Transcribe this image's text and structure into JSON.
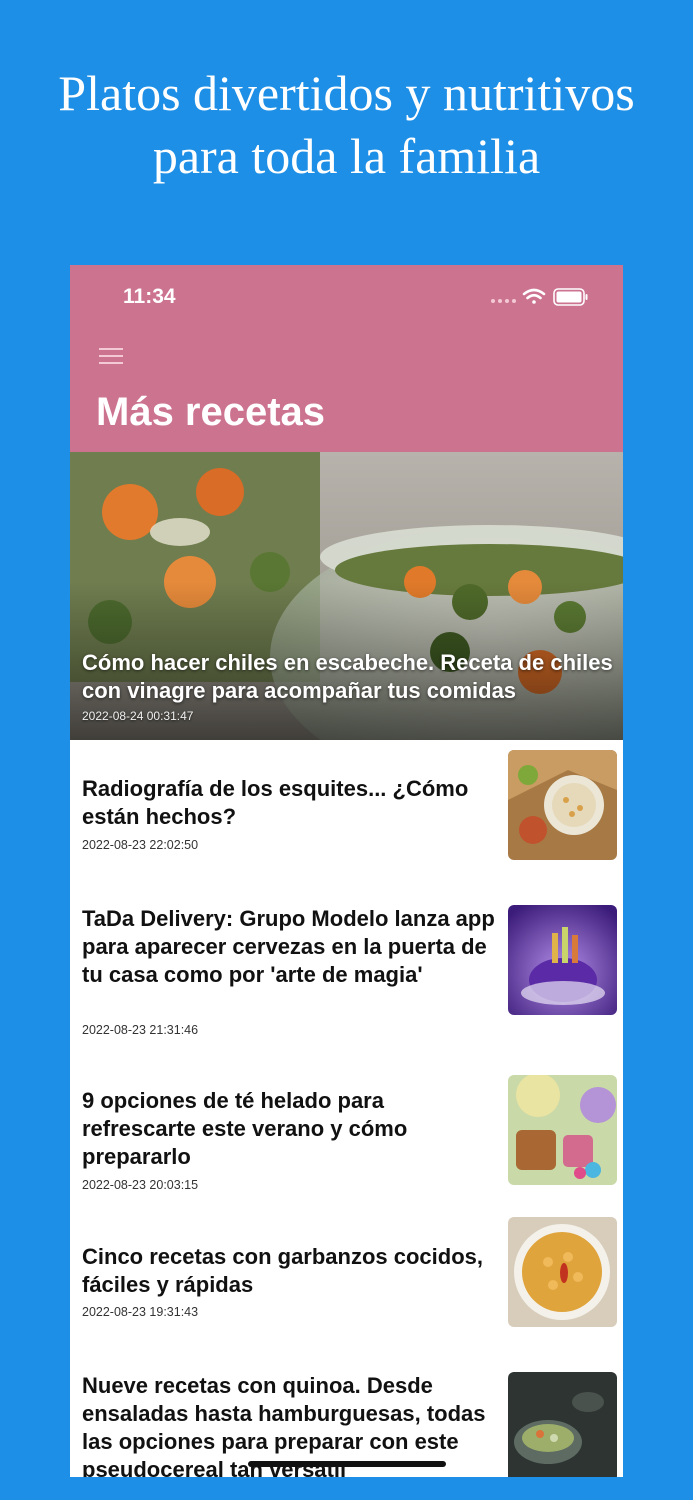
{
  "promo": {
    "title_line1": "Platos divertidos y nutritivos",
    "title_line2": "para toda la familia"
  },
  "status_bar": {
    "time": "11:34"
  },
  "header": {
    "title": "Más recetas"
  },
  "hero": {
    "title": "Cómo hacer chiles en escabeche. Receta de chiles con vinagre para acompañar tus comidas",
    "date": "2022-08-24 00:31:47"
  },
  "articles": [
    {
      "title": "Radiografía de los esquites... ¿Cómo están hechos?",
      "date": "2022-08-23 22:02:50"
    },
    {
      "title": "TaDa Delivery: Grupo Modelo lanza app para aparecer cervezas en la puerta de tu casa como por 'arte de magia'",
      "date": "2022-08-23 21:31:46"
    },
    {
      "title": "9 opciones de té helado para refrescarte este verano y cómo prepararlo",
      "date": "2022-08-23 20:03:15"
    },
    {
      "title": "Cinco recetas con garbanzos cocidos, fáciles y rápidas",
      "date": "2022-08-23 19:31:43"
    },
    {
      "title": "Nueve recetas con quinoa. Desde ensaladas hasta hamburguesas, todas las opciones para preparar con este pseudocereal tan versátil",
      "date": ""
    }
  ],
  "colors": {
    "background": "#1e8fe6",
    "appbar": "#cc7390",
    "text": "#111111"
  },
  "icons": {
    "menu": "hamburger-menu-icon",
    "wifi": "wifi-icon",
    "battery": "battery-icon",
    "signal": "signal-icon"
  }
}
